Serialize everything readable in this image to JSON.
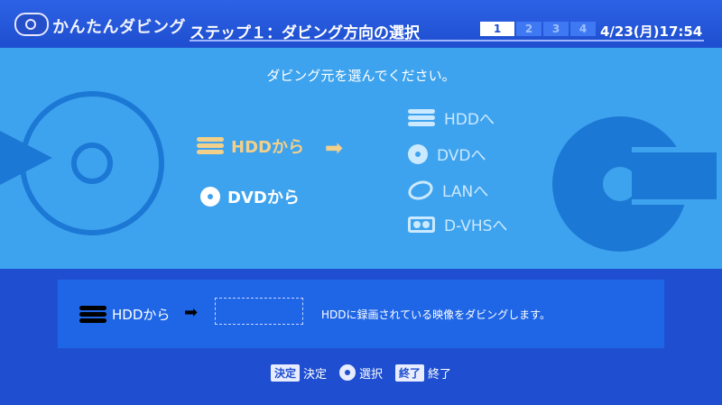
{
  "header": {
    "app_title": "かんたんダビング",
    "step_title": "ステップ１：ダビング方向の選択",
    "steps": [
      "1",
      "2",
      "3",
      "4"
    ],
    "active_step": "1",
    "datetime": "4/23(月)17:54"
  },
  "main": {
    "prompt": "ダビング元を選んでください。",
    "sources": [
      {
        "label": "HDDから",
        "icon": "hdd-icon",
        "selected": true
      },
      {
        "label": "DVDから",
        "icon": "disc-icon",
        "selected": false
      }
    ],
    "destinations": [
      {
        "label": "HDDへ",
        "icon": "hdd-icon"
      },
      {
        "label": "DVDへ",
        "icon": "disc-icon"
      },
      {
        "label": "LANへ",
        "icon": "lan-icon"
      },
      {
        "label": "D-VHSへ",
        "icon": "tape-icon"
      }
    ]
  },
  "info": {
    "source_label": "HDDから",
    "description": "HDDに録画されている映像をダビングします。"
  },
  "footer": {
    "items": [
      {
        "key": "決定",
        "label": "決定"
      },
      {
        "key": "cross",
        "label": "選択"
      },
      {
        "key": "終了",
        "label": "終了"
      }
    ]
  },
  "colors": {
    "background": "#1f4fd0",
    "panel": "#3ea3ee",
    "selected": "#f2d08a",
    "inactive": "#cbe9ff"
  }
}
